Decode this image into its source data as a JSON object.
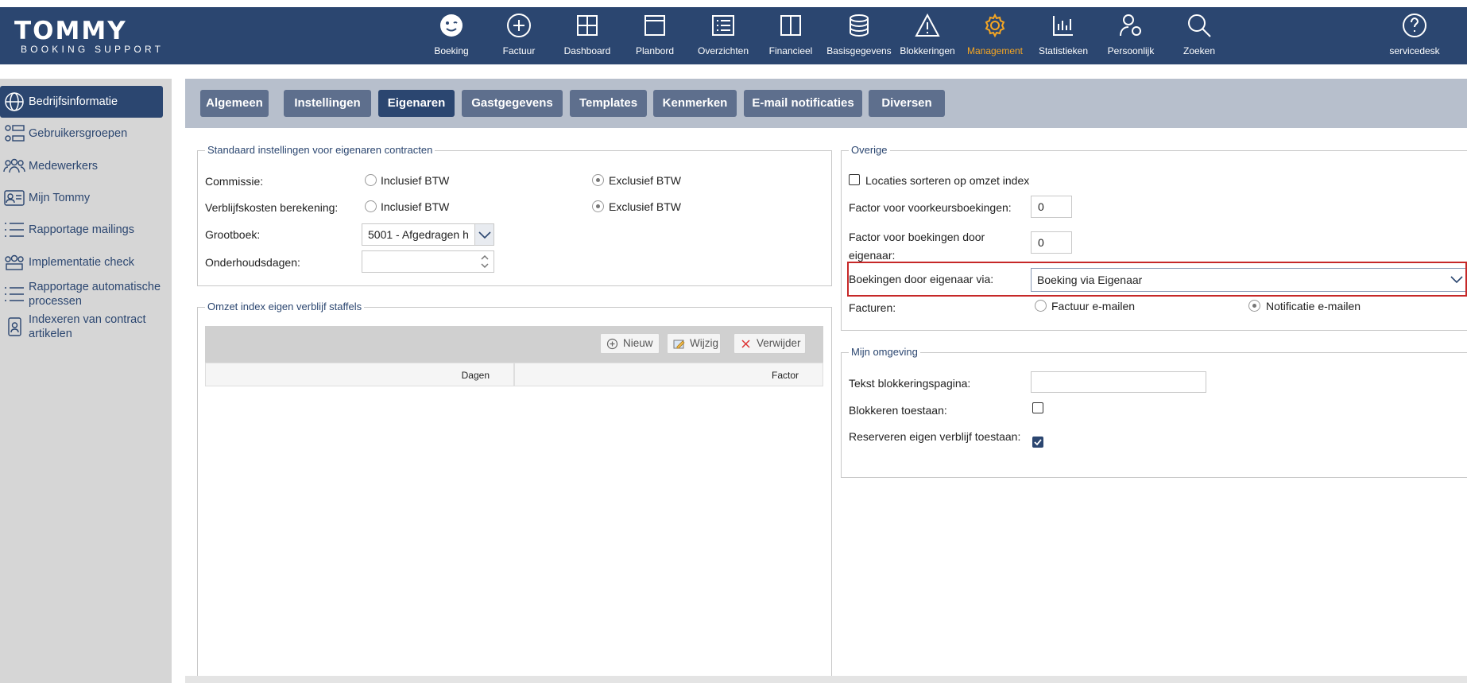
{
  "header": {
    "logo_main": "TOMMY",
    "logo_sub": "BOOKING SUPPORT",
    "nav": [
      {
        "label": "Boeking",
        "icon": "smiley-icon"
      },
      {
        "label": "Factuur",
        "icon": "plus-circle-icon"
      },
      {
        "label": "Dashboard",
        "icon": "grid-icon"
      },
      {
        "label": "Planbord",
        "icon": "window-icon"
      },
      {
        "label": "Overzichten",
        "icon": "list-icon"
      },
      {
        "label": "Financieel",
        "icon": "book-icon"
      },
      {
        "label": "Basisgegevens",
        "icon": "database-icon"
      },
      {
        "label": "Blokkeringen",
        "icon": "warning-icon"
      },
      {
        "label": "Management",
        "icon": "gear-icon",
        "active": true
      },
      {
        "label": "Statistieken",
        "icon": "bar-chart-icon"
      },
      {
        "label": "Persoonlijk",
        "icon": "user-gear-icon"
      },
      {
        "label": "Zoeken",
        "icon": "search-icon"
      }
    ],
    "help_label": "servicedesk",
    "accent_color": "#f5a623",
    "brand_color": "#2b4670"
  },
  "sidebar": {
    "items": [
      {
        "label": "Bedrijfsinformatie",
        "icon": "globe-icon",
        "active": true
      },
      {
        "label": "Gebruikersgroepen",
        "icon": "user-group-list-icon"
      },
      {
        "label": "Medewerkers",
        "icon": "users-icon"
      },
      {
        "label": "Mijn Tommy",
        "icon": "id-card-icon"
      },
      {
        "label": "Rapportage mailings",
        "icon": "list-icon"
      },
      {
        "label": "Implementatie check",
        "icon": "users-check-icon"
      },
      {
        "label": "Rapportage automatische processen",
        "icon": "list-icon"
      },
      {
        "label": "Indexeren van contract artikelen",
        "icon": "contract-icon"
      }
    ]
  },
  "tabs": [
    "Algemeen",
    "Instellingen",
    "Eigenaren",
    "Gastgegevens",
    "Templates",
    "Kenmerken",
    "E-mail notificaties",
    "Diversen"
  ],
  "active_tab": "Eigenaren",
  "standaard": {
    "legend": "Standaard instellingen voor eigenaren contracten",
    "commissie_label": "Commissie:",
    "verblijf_label": "Verblijfskosten berekening:",
    "incl_label": "Inclusief BTW",
    "excl_label": "Exclusief BTW",
    "commissie_value": "Exclusief BTW",
    "verblijf_value": "Exclusief BTW",
    "grootboek_label": "Grootboek:",
    "grootboek_value": "5001 - Afgedragen h",
    "onderhoud_label": "Onderhoudsdagen:",
    "onderhoud_value": ""
  },
  "omzet": {
    "legend": "Omzet index eigen verblijf staffels",
    "new_label": "Nieuw",
    "edit_label": "Wijzig",
    "delete_label": "Verwijder",
    "columns": [
      "Dagen",
      "Factor"
    ],
    "rows": []
  },
  "overige": {
    "legend": "Overige",
    "sort_label": "Locaties sorteren op omzet index",
    "sort_checked": false,
    "factor_voorkeur_label": "Factor voor voorkeursboekingen:",
    "factor_voorkeur_value": "0",
    "factor_eigenaar_label": "Factor voor boekingen door eigenaar:",
    "factor_eigenaar_value": "0",
    "boekingen_via_label": "Boekingen door eigenaar via:",
    "boekingen_via_value": "Boeking via Eigenaar",
    "facturen_label": "Facturen:",
    "factuur_email_label": "Factuur e-mailen",
    "notificatie_email_label": "Notificatie e-mailen",
    "facturen_value": "Notificatie e-mailen"
  },
  "omgeving": {
    "legend": "Mijn omgeving",
    "tekst_label": "Tekst blokkeringspagina:",
    "tekst_value": "",
    "blokkeren_label": "Blokkeren toestaan:",
    "blokkeren_checked": false,
    "reserveren_label": "Reserveren eigen verblijf toestaan:",
    "reserveren_checked": true
  }
}
